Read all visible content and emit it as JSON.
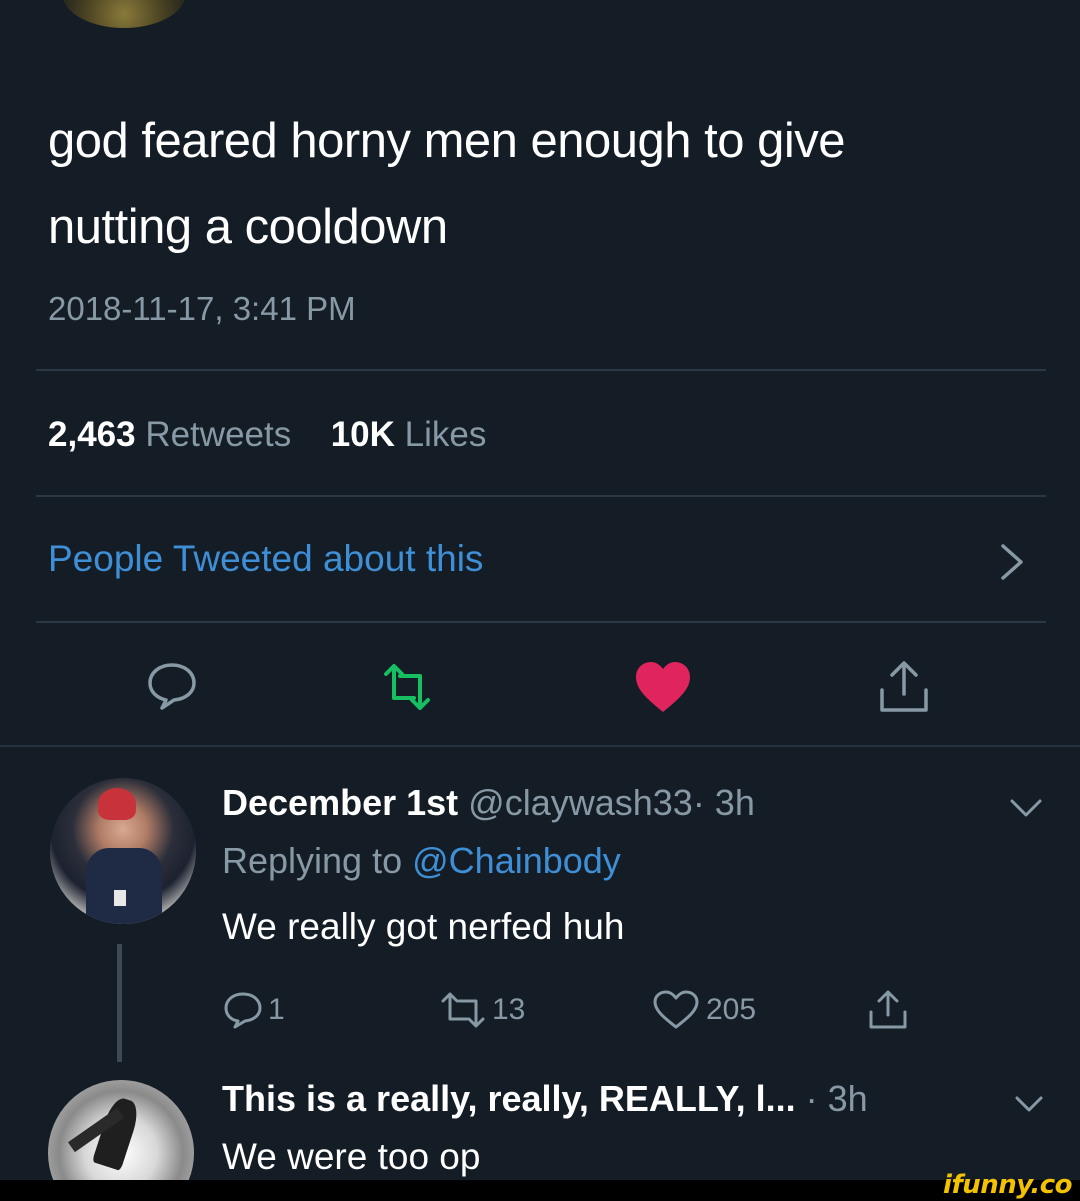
{
  "tweet": {
    "text_line1": "god feared horny men enough to give",
    "text_line2": "nutting a cooldown",
    "timestamp": "2018-11-17, 3:41 PM",
    "retweets_count": "2,463",
    "retweets_label": "Retweets",
    "likes_count": "10K",
    "likes_label": "Likes",
    "people_tweeted": "People Tweeted about this"
  },
  "actions": {
    "reply_icon": "speech-bubble-icon",
    "retweet_icon": "retweet-icon",
    "like_icon": "heart-filled-icon",
    "share_icon": "share-icon"
  },
  "reply1": {
    "name": "December 1st",
    "handle": "@claywash33",
    "time": "· 3h",
    "replying_prefix": "Replying to",
    "replying_to": "@Chainbody",
    "body": "We really got nerfed huh",
    "reply_count": "1",
    "retweet_count": "13",
    "like_count": "205"
  },
  "reply2": {
    "name": "This is a really, really, REALLY, l...",
    "time": "· 3h",
    "body": "We were too op"
  },
  "watermark": "ifunny.co",
  "colors": {
    "background": "#141d26",
    "accent_blue": "#3f8fd6",
    "muted": "#8899a6",
    "retweet_green": "#17bf63",
    "like_red": "#e0245e"
  }
}
